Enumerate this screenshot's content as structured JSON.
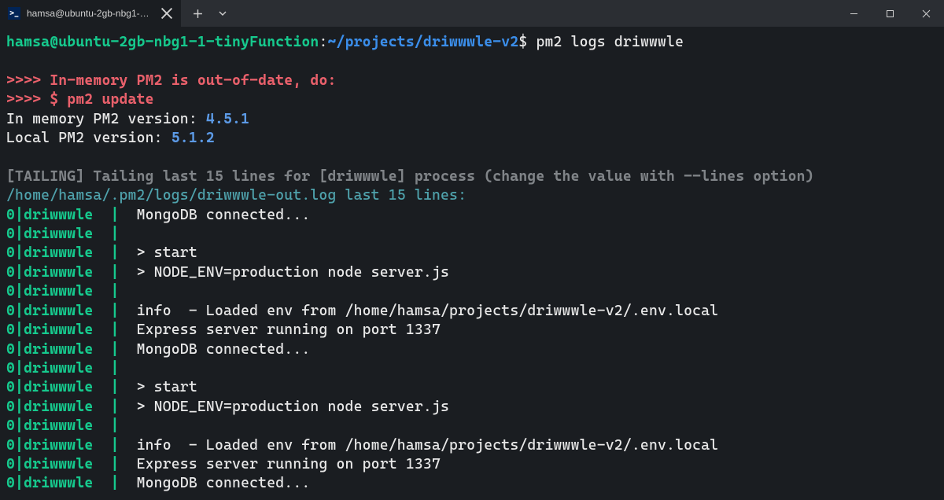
{
  "titlebar": {
    "tab_title": "hamsa@ubuntu-2gb-nbg1-1-tin",
    "tab_icon_glyph": ">_"
  },
  "prompt": {
    "user_host": "hamsa@ubuntu-2gb-nbg1-1-tinyFunction",
    "colon": ":",
    "path": "~/projects/driwwwle-v2",
    "dollar": "$",
    "command": " pm2 logs driwwwle"
  },
  "warn": {
    "line1_prefix": ">>>> ",
    "line1_text": "In-memory PM2 is out-of-date, do:",
    "line2_prefix": ">>>> ",
    "line2_text": "$ pm2 update"
  },
  "versions": {
    "in_mem_label": "In memory PM2 version: ",
    "in_mem_value": "4.5.1",
    "local_label": "Local PM2 version: ",
    "local_value": "5.1.2"
  },
  "tailing": {
    "header": "[TAILING] Tailing last 15 lines for [driwwwle] process (change the value with --lines option)",
    "filepath": "/home/hamsa/.pm2/logs/driwwwle-out.log last 15 lines:"
  },
  "log_prefix": "0|driwwwle  | ",
  "log_lines": [
    " MongoDB connected...",
    "",
    " > start",
    " > NODE_ENV=production node server.js",
    "",
    " info  - Loaded env from /home/hamsa/projects/driwwwle-v2/.env.local",
    " Express server running on port 1337",
    " MongoDB connected...",
    "",
    " > start",
    " > NODE_ENV=production node server.js",
    "",
    " info  - Loaded env from /home/hamsa/projects/driwwwle-v2/.env.local",
    " Express server running on port 1337",
    " MongoDB connected..."
  ]
}
